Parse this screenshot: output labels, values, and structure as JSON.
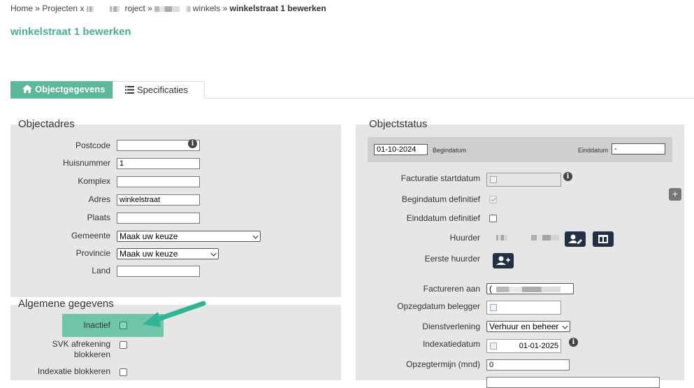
{
  "breadcrumb": {
    "home": "Home",
    "sep": "»",
    "projects": "Projecten",
    "project_suffix": "roject",
    "winkels": "winkels",
    "current": "winkelstraat 1 bewerken"
  },
  "page_title": "winkelstraat 1 bewerken",
  "tabs": [
    {
      "label": "Objectgegevens",
      "icon": "home-icon",
      "active": true
    },
    {
      "label": "Specificaties",
      "icon": "list-icon",
      "active": false
    }
  ],
  "objectadres": {
    "title": "Objectadres",
    "postcode": {
      "label": "Postcode",
      "value": ""
    },
    "huisnummer": {
      "label": "Huisnummer",
      "value": "1"
    },
    "komplex": {
      "label": "Komplex",
      "value": ""
    },
    "adres": {
      "label": "Adres",
      "value": "winkelstraat"
    },
    "plaats": {
      "label": "Plaats",
      "value": ""
    },
    "gemeente": {
      "label": "Gemeente",
      "value": "Maak uw keuze"
    },
    "provincie": {
      "label": "Provincie",
      "value": "Maak uw keuze"
    },
    "land": {
      "label": "Land",
      "value": ""
    }
  },
  "algemene": {
    "title": "Algemene gegevens",
    "inactief": "Inactief",
    "svk_line1": "SVK afrekening",
    "svk_line2": "blokkeren",
    "indexatie_blokkeren": "Indexatie blokkeren"
  },
  "objectstatus": {
    "title": "Objectstatus",
    "begindatum": {
      "label": "Begindatum",
      "value": "01-10-2024"
    },
    "einddatum": {
      "label": "Einddatum",
      "value": "-"
    },
    "facturatie_startdatum": {
      "label": "Facturatie startdatum",
      "value": ""
    },
    "begindatum_definitief": {
      "label": "Begindatum definitief",
      "checked": true
    },
    "einddatum_definitief": {
      "label": "Einddatum definitief",
      "checked": false
    },
    "huurder": {
      "label": "Huurder"
    },
    "eerste_huurder": {
      "label": "Eerste huurder"
    },
    "factureren_aan": {
      "label": "Factureren aan",
      "value": "("
    },
    "opzegdatum_belegger": {
      "label": "Opzegdatum belegger",
      "value": ""
    },
    "dienstverlening": {
      "label": "Dienstverlening",
      "value": "Verhuur en beheer"
    },
    "indexatiedatum": {
      "label": "Indexatiedatum",
      "value": "01-01-2025"
    },
    "opzegtermijn": {
      "label": "Opzegtermijn (mnd)",
      "value": "0"
    },
    "plus": "+"
  },
  "colors": {
    "accent": "#5cb896",
    "title": "#4caf8a",
    "arrow": "#2fb596",
    "button": "#223044"
  }
}
